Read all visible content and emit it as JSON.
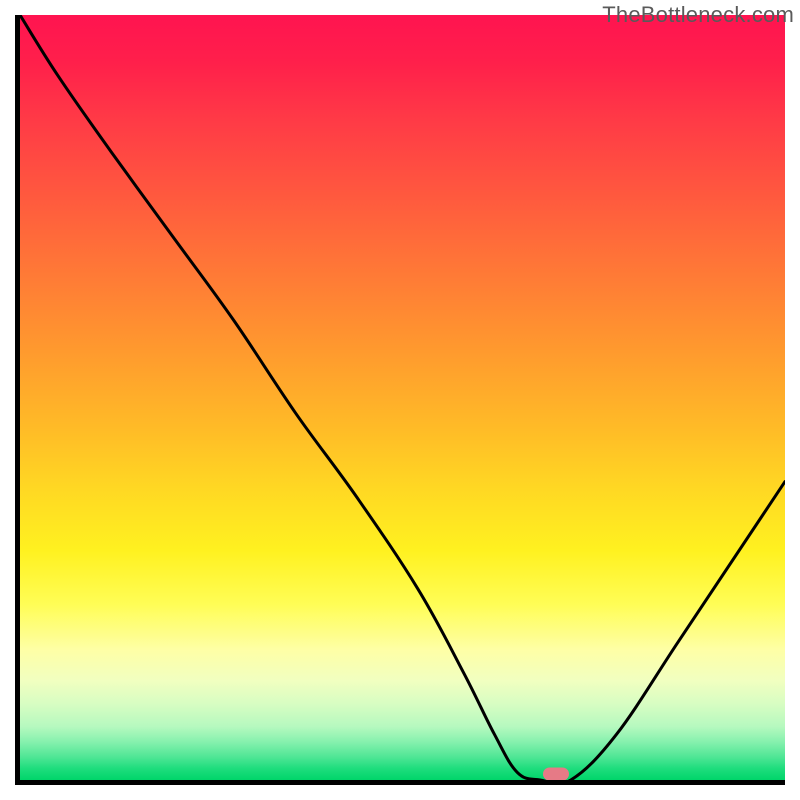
{
  "watermark": "TheBottleneck.com",
  "chart_data": {
    "type": "line",
    "title": "",
    "xlabel": "",
    "ylabel": "",
    "xlim": [
      0,
      100
    ],
    "ylim": [
      0,
      100
    ],
    "grid": false,
    "legend": false,
    "background": "heatmap-gradient-red-to-green-vertical",
    "series": [
      {
        "name": "bottleneck-curve",
        "x": [
          0,
          5,
          12,
          20,
          28,
          36,
          44,
          52,
          58,
          62,
          65,
          68,
          72,
          78,
          86,
          94,
          100
        ],
        "values": [
          100,
          92,
          82,
          71,
          60,
          48,
          37,
          25,
          14,
          6,
          1,
          0,
          0,
          6,
          18,
          30,
          39
        ]
      }
    ],
    "marker": {
      "x": 70,
      "y": 0,
      "color": "#e67a86",
      "shape": "pill"
    },
    "colors": {
      "curve": "#000000",
      "axis": "#000000",
      "gradient_top": "#ff1450",
      "gradient_mid": "#ffd823",
      "gradient_bottom": "#00d56a"
    }
  }
}
